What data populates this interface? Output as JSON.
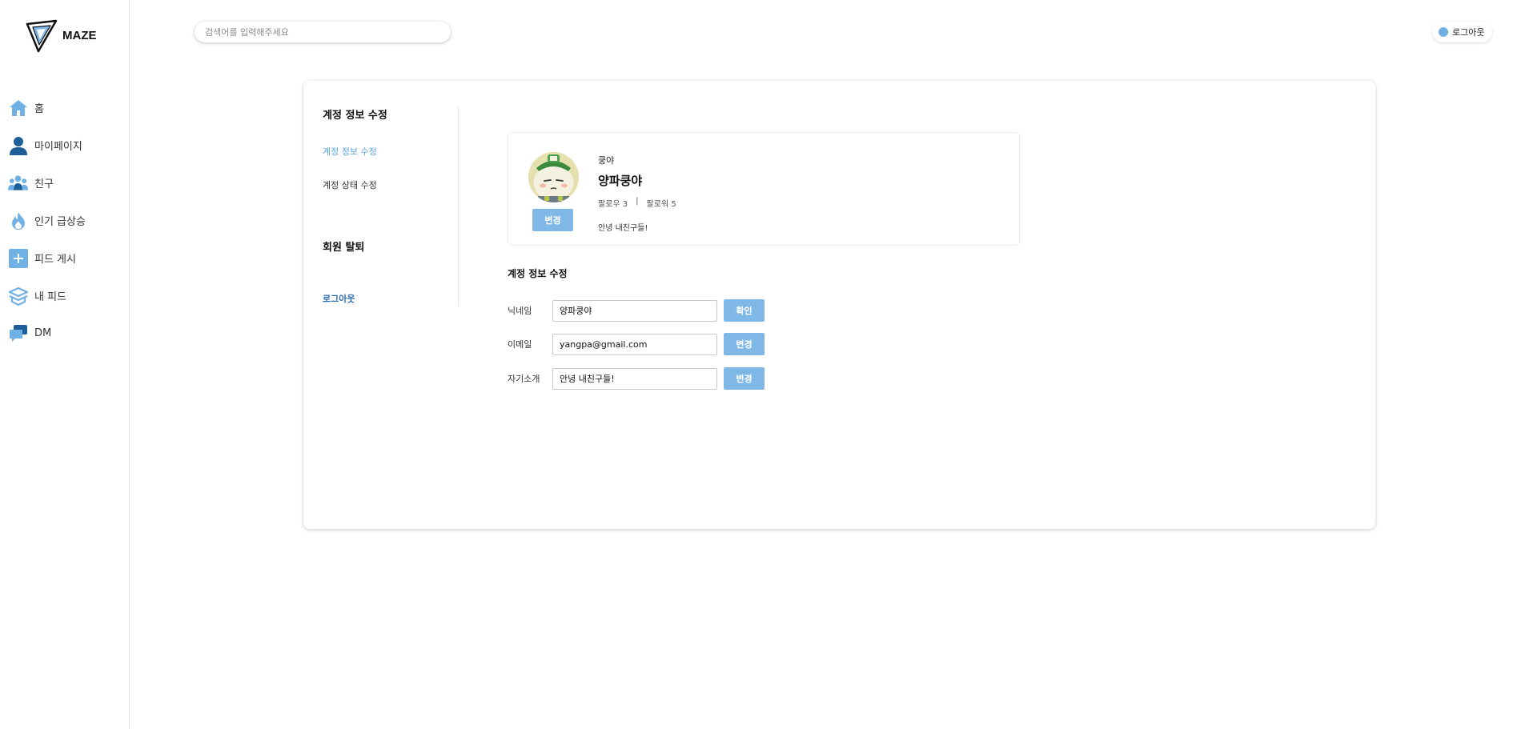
{
  "app": {
    "logo_text": "MAZE"
  },
  "sidebar": {
    "items": [
      {
        "label": "홈",
        "icon": "home-icon"
      },
      {
        "label": "마이페이지",
        "icon": "user-icon"
      },
      {
        "label": "친구",
        "icon": "friends-icon"
      },
      {
        "label": "인기 급상승",
        "icon": "fire-icon"
      },
      {
        "label": "피드 게시",
        "icon": "plus-icon"
      },
      {
        "label": "내 피드",
        "icon": "feed-icon"
      },
      {
        "label": "DM",
        "icon": "chat-icon"
      }
    ]
  },
  "header": {
    "search_placeholder": "검색어를 입력해주세요",
    "logout_label": "로그아웃"
  },
  "settings_menu": {
    "heading": "계정 정보 수정",
    "item_edit": "계정 정보 수정",
    "item_status": "계정 상태 수정",
    "withdraw": "회원 탈퇴",
    "logout": "로그아웃"
  },
  "profile": {
    "nickname_small": "쿵야",
    "name": "양파쿵야",
    "following_label": "팔로우",
    "following_count": "3",
    "separator": "|",
    "followers_label": "팔로워",
    "followers_count": "5",
    "bio": "안녕 내친구들!",
    "change_button": "변경"
  },
  "form": {
    "title": "계정 정보 수정",
    "nickname_label": "닉네임",
    "nickname_value": "양파쿵야",
    "nickname_button": "확인",
    "email_label": "이메일",
    "email_value": "yangpa@gmail.com",
    "email_button": "변경",
    "bio_label": "자기소개",
    "bio_value": "안녕 내친구들!",
    "bio_button": "변경"
  },
  "colors": {
    "accent": "#7fb8e6",
    "nav_icon": "#5aa2dc",
    "dark_icon": "#1f5f99"
  }
}
